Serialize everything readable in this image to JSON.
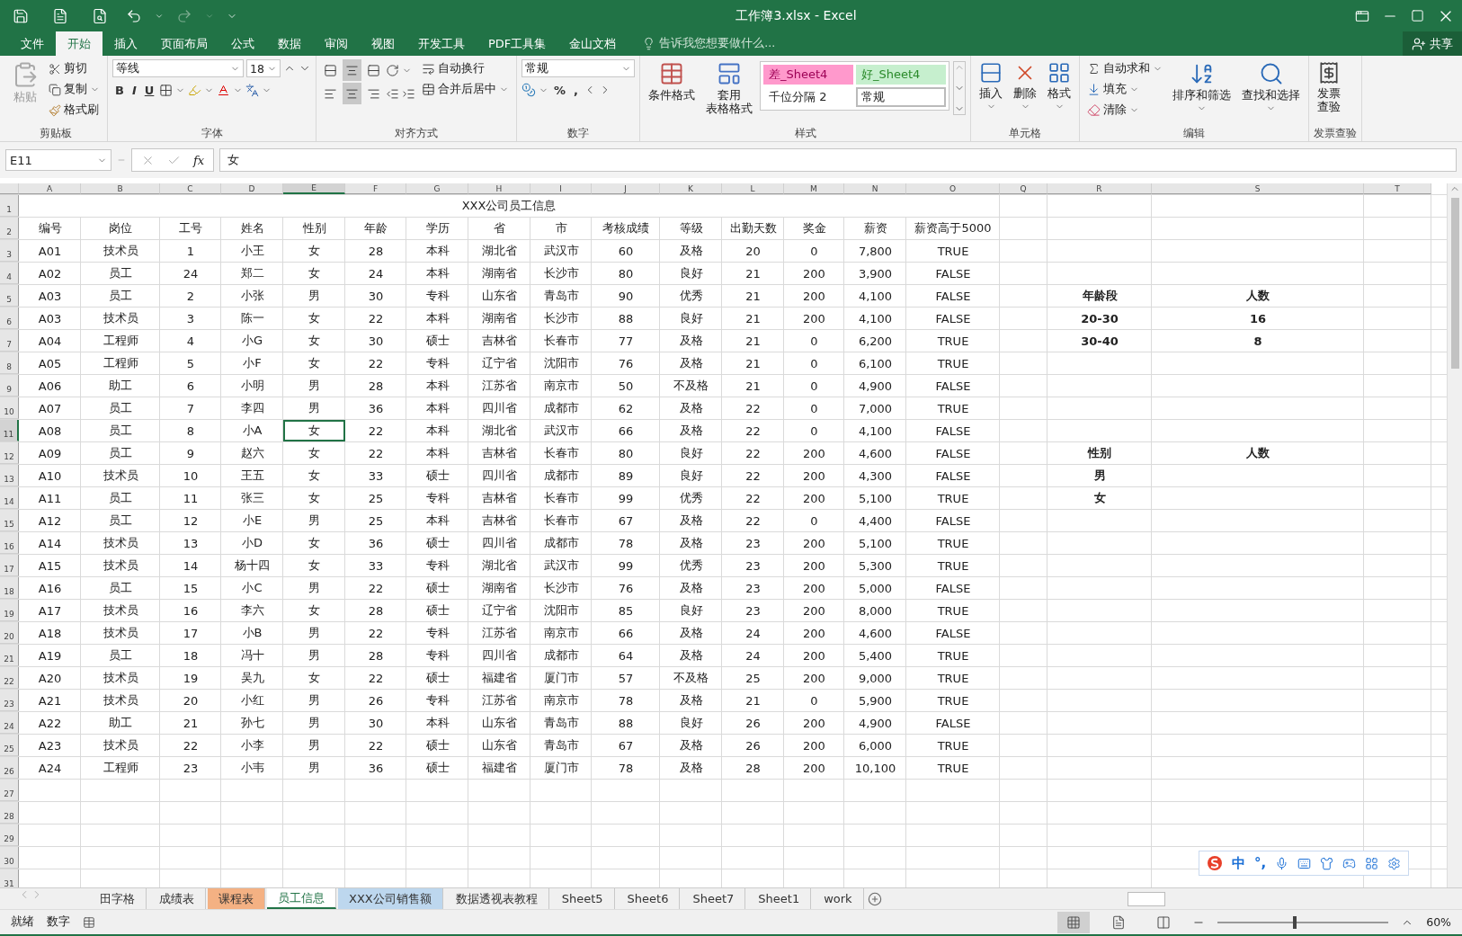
{
  "title_bar": {
    "title": "工作簿3.xlsx - Excel"
  },
  "menu_tabs": [
    {
      "label": "文件",
      "selected": false
    },
    {
      "label": "开始",
      "selected": true
    },
    {
      "label": "插入",
      "selected": false
    },
    {
      "label": "页面布局",
      "selected": false
    },
    {
      "label": "公式",
      "selected": false
    },
    {
      "label": "数据",
      "selected": false
    },
    {
      "label": "审阅",
      "selected": false
    },
    {
      "label": "视图",
      "selected": false
    },
    {
      "label": "开发工具",
      "selected": false
    },
    {
      "label": "PDF工具集",
      "selected": false
    },
    {
      "label": "金山文档",
      "selected": false
    }
  ],
  "tell_me": "告诉我您想要做什么...",
  "share": "共享",
  "ribbon": {
    "clipboard": {
      "label": "剪贴板",
      "paste": {
        "label": "粘贴",
        "disabled": true
      },
      "cut": "剪切",
      "copy": "复制",
      "format_painter": "格式刷"
    },
    "font": {
      "label": "字体",
      "font_name": "等线",
      "font_size": "18",
      "bold": "B",
      "italic": "I",
      "underline": "U"
    },
    "alignment": {
      "label": "对齐方式",
      "vertical": [
        {
          "kind": "top",
          "selected": false
        },
        {
          "kind": "middle",
          "selected": true
        },
        {
          "kind": "bottom",
          "selected": false
        }
      ],
      "horizontal": [
        {
          "kind": "left",
          "selected": false
        },
        {
          "kind": "center",
          "selected": true
        },
        {
          "kind": "right",
          "selected": false
        }
      ],
      "wrap_text": "自动换行",
      "merge_center": "合并后居中"
    },
    "number": {
      "label": "数字",
      "format": "常规",
      "percent": "%",
      "comma": ","
    },
    "styles": {
      "label": "样式",
      "conditional_formatting": "条件格式",
      "format_as_table": [
        "套用",
        "表格格式"
      ],
      "gallery": [
        {
          "label": "差_Sheet4",
          "kind": "bad",
          "selected": false
        },
        {
          "label": "好_Sheet4",
          "kind": "good",
          "selected": false
        },
        {
          "label": "千位分隔 2",
          "kind": "plain",
          "selected": false
        },
        {
          "label": "常规",
          "kind": "plain",
          "selected": true
        }
      ]
    },
    "cells": {
      "label": "单元格",
      "insert": "插入",
      "delete": "删除",
      "format": "格式"
    },
    "editing": {
      "label": "编辑",
      "autosum": "自动求和",
      "fill": "填充",
      "clear": "清除",
      "sort_filter": "排序和筛选",
      "find_select": "查找和选择"
    },
    "invoice": {
      "label": "发票查验",
      "button": [
        "发票",
        "查验"
      ]
    }
  },
  "formula_bar": {
    "name_box": "E11",
    "function_label": "fx",
    "formula": "女"
  },
  "columns": [
    {
      "label": "A",
      "selected": false
    },
    {
      "label": "B",
      "selected": false
    },
    {
      "label": "C",
      "selected": false
    },
    {
      "label": "D",
      "selected": false
    },
    {
      "label": "E",
      "selected": true
    },
    {
      "label": "F",
      "selected": false
    },
    {
      "label": "G",
      "selected": false
    },
    {
      "label": "H",
      "selected": false
    },
    {
      "label": "I",
      "selected": false
    },
    {
      "label": "J",
      "selected": false
    },
    {
      "label": "K",
      "selected": false
    },
    {
      "label": "L",
      "selected": false
    },
    {
      "label": "M",
      "selected": false
    },
    {
      "label": "N",
      "selected": false
    },
    {
      "label": "O",
      "selected": false
    },
    {
      "label": "Q",
      "selected": false
    },
    {
      "label": "R",
      "selected": false
    },
    {
      "label": "S",
      "selected": false
    },
    {
      "label": "T",
      "selected": false
    }
  ],
  "row_numbers": [
    {
      "label": "1",
      "selected": false
    },
    {
      "label": "2",
      "selected": false
    },
    {
      "label": "3",
      "selected": false
    },
    {
      "label": "4",
      "selected": false
    },
    {
      "label": "5",
      "selected": false
    },
    {
      "label": "6",
      "selected": false
    },
    {
      "label": "7",
      "selected": false
    },
    {
      "label": "8",
      "selected": false
    },
    {
      "label": "9",
      "selected": false
    },
    {
      "label": "10",
      "selected": false
    },
    {
      "label": "11",
      "selected": true
    },
    {
      "label": "12",
      "selected": false
    },
    {
      "label": "13",
      "selected": false
    },
    {
      "label": "14",
      "selected": false
    },
    {
      "label": "15",
      "selected": false
    },
    {
      "label": "16",
      "selected": false
    },
    {
      "label": "17",
      "selected": false
    },
    {
      "label": "18",
      "selected": false
    },
    {
      "label": "19",
      "selected": false
    },
    {
      "label": "20",
      "selected": false
    },
    {
      "label": "21",
      "selected": false
    },
    {
      "label": "22",
      "selected": false
    },
    {
      "label": "23",
      "selected": false
    },
    {
      "label": "24",
      "selected": false
    },
    {
      "label": "25",
      "selected": false
    },
    {
      "label": "26",
      "selected": false
    },
    {
      "label": "27",
      "selected": false
    },
    {
      "label": "28",
      "selected": false
    },
    {
      "label": "29",
      "selected": false
    },
    {
      "label": "30",
      "selected": false
    },
    {
      "label": "31",
      "selected": false
    }
  ],
  "table": {
    "title": "XXX公司员工信息",
    "headers": [
      "编号",
      "岗位",
      "工号",
      "姓名",
      "性别",
      "年龄",
      "学历",
      "省",
      "市",
      "考核成绩",
      "等级",
      "出勤天数",
      "奖金",
      "薪资",
      "薪资高于5000"
    ],
    "rows": [
      [
        "A01",
        "技术员",
        "1",
        "小王",
        "女",
        "28",
        "本科",
        "湖北省",
        "武汉市",
        "60",
        "及格",
        "20",
        "0",
        "7,800",
        "TRUE"
      ],
      [
        "A02",
        "员工",
        "24",
        "郑二",
        "女",
        "24",
        "本科",
        "湖南省",
        "长沙市",
        "80",
        "良好",
        "21",
        "200",
        "3,900",
        "FALSE"
      ],
      [
        "A03",
        "员工",
        "2",
        "小张",
        "男",
        "30",
        "专科",
        "山东省",
        "青岛市",
        "90",
        "优秀",
        "21",
        "200",
        "4,100",
        "FALSE"
      ],
      [
        "A03",
        "技术员",
        "3",
        "陈一",
        "女",
        "22",
        "本科",
        "湖南省",
        "长沙市",
        "88",
        "良好",
        "21",
        "200",
        "4,100",
        "FALSE"
      ],
      [
        "A04",
        "工程师",
        "4",
        "小G",
        "女",
        "30",
        "硕士",
        "吉林省",
        "长春市",
        "77",
        "及格",
        "21",
        "0",
        "6,200",
        "TRUE"
      ],
      [
        "A05",
        "工程师",
        "5",
        "小F",
        "女",
        "22",
        "专科",
        "辽宁省",
        "沈阳市",
        "76",
        "及格",
        "21",
        "0",
        "6,100",
        "TRUE"
      ],
      [
        "A06",
        "助工",
        "6",
        "小明",
        "男",
        "28",
        "本科",
        "江苏省",
        "南京市",
        "50",
        "不及格",
        "21",
        "0",
        "4,900",
        "FALSE"
      ],
      [
        "A07",
        "员工",
        "7",
        "李四",
        "男",
        "36",
        "本科",
        "四川省",
        "成都市",
        "62",
        "及格",
        "22",
        "0",
        "7,000",
        "TRUE"
      ],
      [
        "A08",
        "员工",
        "8",
        "小A",
        "女",
        "22",
        "本科",
        "湖北省",
        "武汉市",
        "66",
        "及格",
        "22",
        "0",
        "4,100",
        "FALSE"
      ],
      [
        "A09",
        "员工",
        "9",
        "赵六",
        "女",
        "22",
        "本科",
        "吉林省",
        "长春市",
        "80",
        "良好",
        "22",
        "200",
        "4,600",
        "FALSE"
      ],
      [
        "A10",
        "技术员",
        "10",
        "王五",
        "女",
        "33",
        "硕士",
        "四川省",
        "成都市",
        "89",
        "良好",
        "22",
        "200",
        "4,300",
        "FALSE"
      ],
      [
        "A11",
        "员工",
        "11",
        "张三",
        "女",
        "25",
        "专科",
        "吉林省",
        "长春市",
        "99",
        "优秀",
        "22",
        "200",
        "5,100",
        "TRUE"
      ],
      [
        "A12",
        "员工",
        "12",
        "小E",
        "男",
        "25",
        "本科",
        "吉林省",
        "长春市",
        "67",
        "及格",
        "22",
        "0",
        "4,400",
        "FALSE"
      ],
      [
        "A14",
        "技术员",
        "13",
        "小D",
        "女",
        "36",
        "硕士",
        "四川省",
        "成都市",
        "78",
        "及格",
        "23",
        "200",
        "5,100",
        "TRUE"
      ],
      [
        "A15",
        "技术员",
        "14",
        "杨十四",
        "女",
        "33",
        "专科",
        "湖北省",
        "武汉市",
        "99",
        "优秀",
        "23",
        "200",
        "5,300",
        "TRUE"
      ],
      [
        "A16",
        "员工",
        "15",
        "小C",
        "男",
        "22",
        "硕士",
        "湖南省",
        "长沙市",
        "76",
        "及格",
        "23",
        "200",
        "5,000",
        "FALSE"
      ],
      [
        "A17",
        "技术员",
        "16",
        "李六",
        "女",
        "28",
        "硕士",
        "辽宁省",
        "沈阳市",
        "85",
        "良好",
        "23",
        "200",
        "8,000",
        "TRUE"
      ],
      [
        "A18",
        "技术员",
        "17",
        "小B",
        "男",
        "22",
        "专科",
        "江苏省",
        "南京市",
        "66",
        "及格",
        "24",
        "200",
        "4,600",
        "FALSE"
      ],
      [
        "A19",
        "员工",
        "18",
        "冯十",
        "男",
        "28",
        "专科",
        "四川省",
        "成都市",
        "64",
        "及格",
        "24",
        "200",
        "5,400",
        "TRUE"
      ],
      [
        "A20",
        "技术员",
        "19",
        "吴九",
        "女",
        "22",
        "硕士",
        "福建省",
        "厦门市",
        "57",
        "不及格",
        "25",
        "200",
        "9,000",
        "TRUE"
      ],
      [
        "A21",
        "技术员",
        "20",
        "小红",
        "男",
        "26",
        "专科",
        "江苏省",
        "南京市",
        "78",
        "及格",
        "21",
        "0",
        "5,900",
        "TRUE"
      ],
      [
        "A22",
        "助工",
        "21",
        "孙七",
        "男",
        "30",
        "本科",
        "山东省",
        "青岛市",
        "88",
        "良好",
        "26",
        "200",
        "4,900",
        "FALSE"
      ],
      [
        "A23",
        "技术员",
        "22",
        "小李",
        "男",
        "22",
        "硕士",
        "山东省",
        "青岛市",
        "67",
        "及格",
        "26",
        "200",
        "6,000",
        "TRUE"
      ],
      [
        "A24",
        "工程师",
        "23",
        "小韦",
        "男",
        "36",
        "硕士",
        "福建省",
        "厦门市",
        "78",
        "及格",
        "28",
        "200",
        "10,100",
        "TRUE"
      ]
    ]
  },
  "summaries": [
    {
      "headers": [
        "年龄段",
        "人数"
      ],
      "rows": [
        [
          "20-30",
          "16"
        ],
        [
          "30-40",
          "8"
        ]
      ]
    },
    {
      "headers": [
        "性别",
        "人数"
      ],
      "rows": [
        [
          "男"
        ],
        [
          "女"
        ]
      ]
    }
  ],
  "sheet_tabs": [
    {
      "label": "田字格",
      "selected": false
    },
    {
      "label": "成绩表",
      "selected": false
    },
    {
      "label": "课程表",
      "selected": false,
      "color": "#f4b183"
    },
    {
      "label": "员工信息",
      "selected": true
    },
    {
      "label": "XXX公司销售额",
      "selected": false,
      "color": "#bdd7ee"
    },
    {
      "label": "数据透视表教程",
      "selected": false
    },
    {
      "label": "Sheet5",
      "selected": false
    },
    {
      "label": "Sheet6",
      "selected": false
    },
    {
      "label": "Sheet7",
      "selected": false
    },
    {
      "label": "Sheet1",
      "selected": false
    },
    {
      "label": "work",
      "selected": false
    }
  ],
  "ime_toolbar": {
    "mode": "中",
    "punctuation": "°,"
  },
  "status_bar": {
    "mode": "就绪",
    "indicator": "数字",
    "zoom": "60%",
    "zoom_slider": {
      "level": 0.45
    },
    "views": [
      {
        "kind": "normal",
        "selected": true
      },
      {
        "kind": "page_layout",
        "selected": false
      },
      {
        "kind": "page_break",
        "selected": false
      }
    ]
  }
}
